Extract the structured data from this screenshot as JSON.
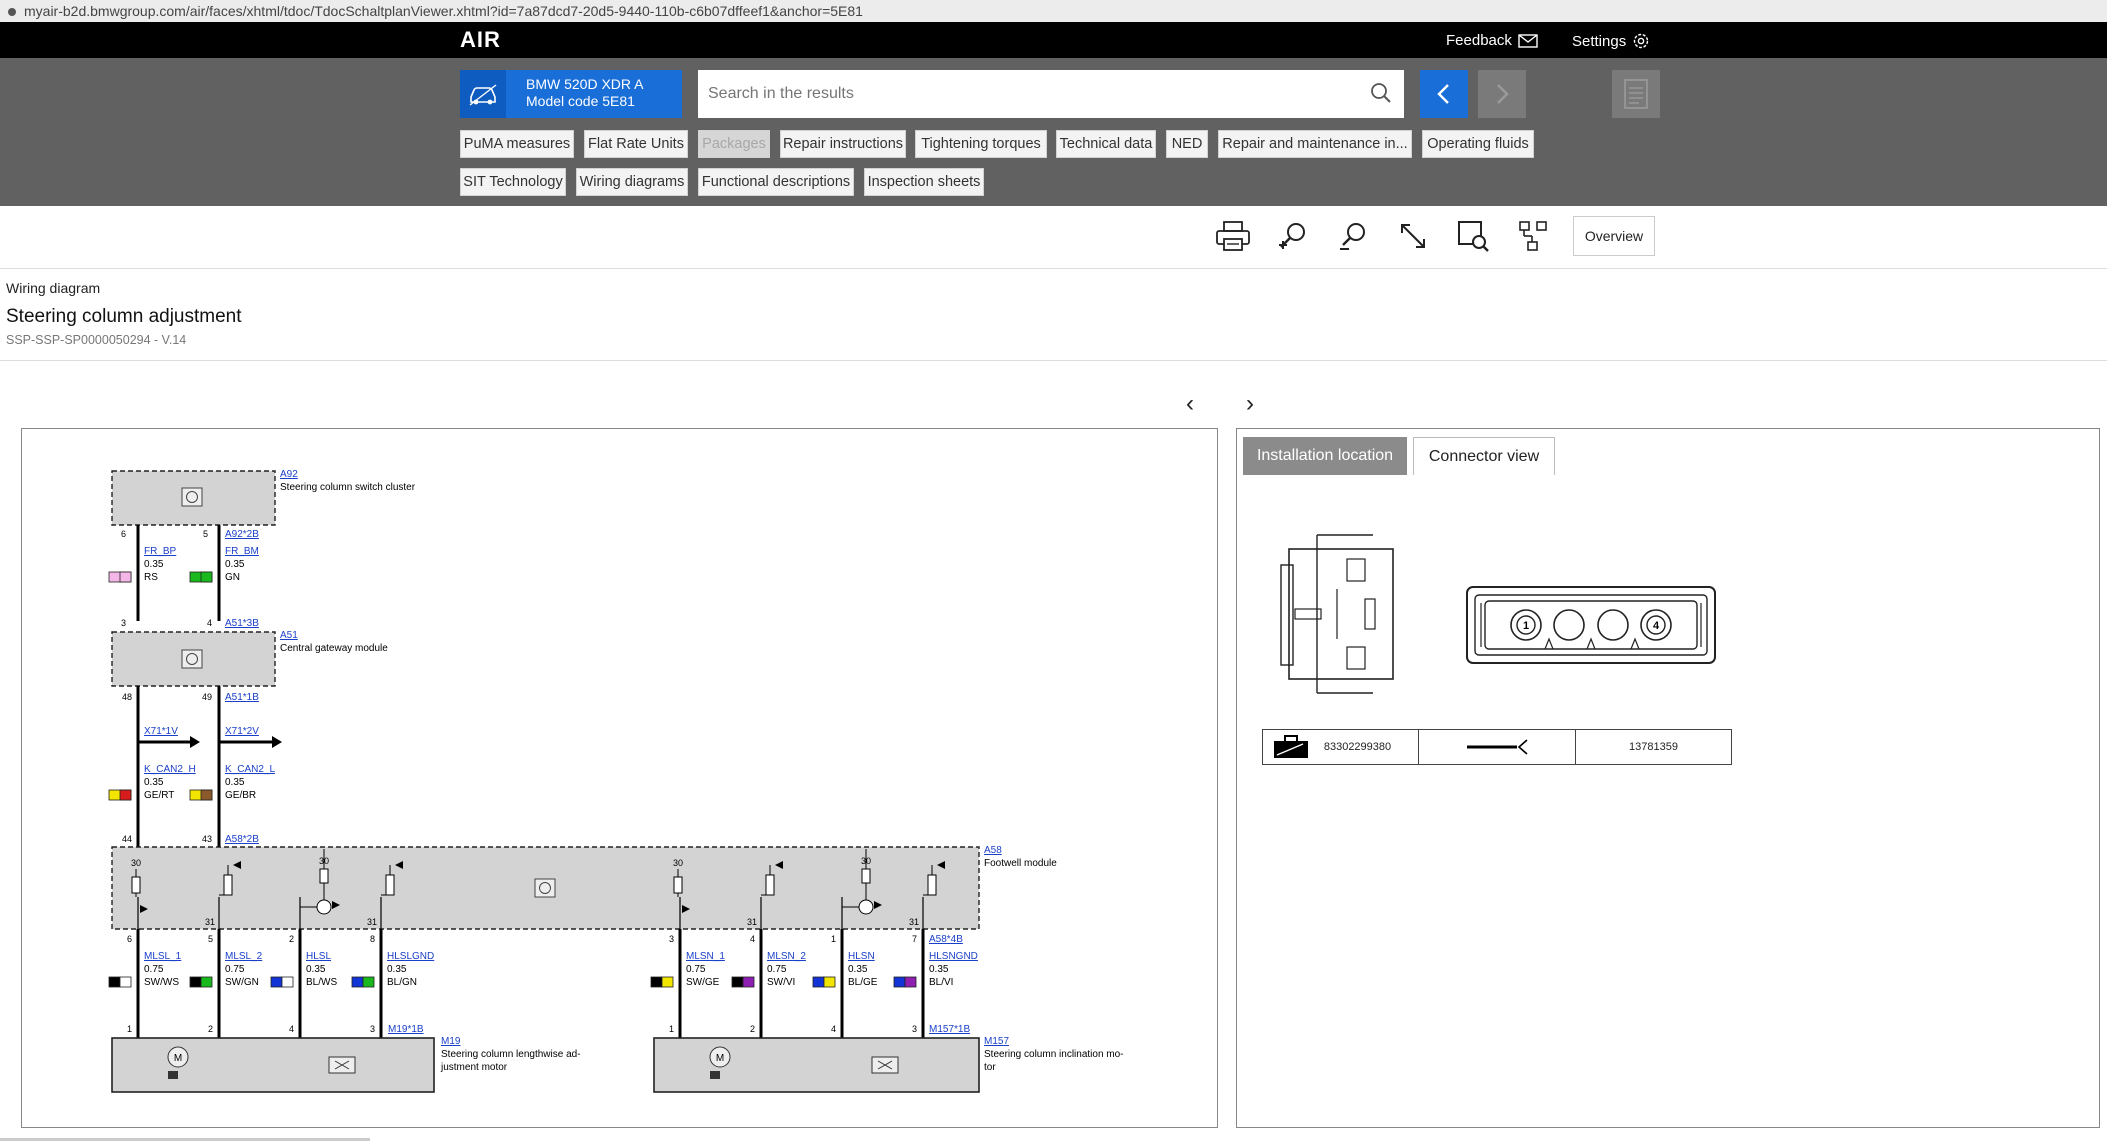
{
  "browser": {
    "url": "myair-b2d.bmwgroup.com/air/faces/xhtml/tdoc/TdocSchaltplanViewer.xhtml?id=7a87dcd7-20d5-9440-110b-c6b07dffeef1&anchor=5E81"
  },
  "header": {
    "logo": "AIR",
    "feedback": "Feedback",
    "settings": "Settings"
  },
  "vehicle": {
    "line1": "BMW 520D XDR A",
    "line2": "Model code 5E81"
  },
  "search": {
    "placeholder": "Search in the results"
  },
  "categories": [
    "PuMA measures",
    "Flat Rate Units",
    "Packages",
    "Repair instructions",
    "Tightening torques",
    "Technical data",
    "NED",
    "Repair and maintenance in...",
    "Operating fluids",
    "SIT Technology",
    "Wiring diagrams",
    "Functional descriptions",
    "Inspection sheets"
  ],
  "toolbar": {
    "overview": "Overview"
  },
  "document": {
    "breadcrumb": "Wiring diagram",
    "title": "Steering column adjustment",
    "id": "SSP-SSP-SP0000050294 - V.14"
  },
  "panel": {
    "tabs": [
      "Installation location",
      "Connector view"
    ],
    "connector_pins": [
      "1",
      "4"
    ],
    "parts": {
      "part_number": "83302299380",
      "number": "13781359"
    }
  },
  "diagram": {
    "a92": {
      "code": "A92",
      "name": "Steering column switch cluster",
      "conn": "A92*2B",
      "pins": [
        "6",
        "5"
      ]
    },
    "w1": [
      {
        "sig": "FR_BP",
        "size": "0.35",
        "color": "RS",
        "c1": "#f4b6e6",
        "c2": "#f4b6e6"
      },
      {
        "sig": "FR_BM",
        "size": "0.35",
        "color": "GN",
        "c1": "#19b91e",
        "c2": "#19b91e"
      }
    ],
    "a51": {
      "code": "A51",
      "name": "Central gateway module",
      "conn_top": "A51*3B",
      "conn_bot": "A51*1B",
      "pins_top": [
        "3",
        "4"
      ],
      "pins_bot": [
        "48",
        "49"
      ]
    },
    "x71": [
      "X71*1V",
      "X71*2V"
    ],
    "w2": [
      {
        "sig": "K_CAN2_H",
        "size": "0.35",
        "color": "GE/RT",
        "c1": "#f2e600",
        "c2": "#d81b1b"
      },
      {
        "sig": "K_CAN2_L",
        "size": "0.35",
        "color": "GE/BR",
        "c1": "#f2e600",
        "c2": "#8b5a2b"
      }
    ],
    "a58": {
      "code": "A58",
      "name": "Footwell module",
      "conn_top": "A58*2B",
      "conn_bot": "A58*4B",
      "pins_top": [
        "44",
        "43"
      ],
      "pins_bot": [
        "6",
        "5",
        "2",
        "8",
        "3",
        "4",
        "1",
        "7"
      ]
    },
    "w3": [
      {
        "sig": "MLSL_1",
        "size": "0.75",
        "color": "SW/WS",
        "c1": "#000000",
        "c2": "#ffffff"
      },
      {
        "sig": "MLSL_2",
        "size": "0.75",
        "color": "SW/GN",
        "c1": "#000000",
        "c2": "#19b91e"
      },
      {
        "sig": "HLSL",
        "size": "0.35",
        "color": "BL/WS",
        "c1": "#1233d6",
        "c2": "#ffffff"
      },
      {
        "sig": "HLSLGND",
        "size": "0.35",
        "color": "BL/GN",
        "c1": "#1233d6",
        "c2": "#19b91e"
      },
      {
        "sig": "MLSN_1",
        "size": "0.75",
        "color": "SW/GE",
        "c1": "#000000",
        "c2": "#f2e600"
      },
      {
        "sig": "MLSN_2",
        "size": "0.75",
        "color": "SW/VI",
        "c1": "#000000",
        "c2": "#8e1fb0"
      },
      {
        "sig": "HLSN",
        "size": "0.35",
        "color": "BL/GE",
        "c1": "#1233d6",
        "c2": "#f2e600"
      },
      {
        "sig": "HLSNGND",
        "size": "0.35",
        "color": "BL/VI",
        "c1": "#1233d6",
        "c2": "#8e1fb0"
      }
    ],
    "terminals": [
      "30",
      "31"
    ],
    "m19": {
      "code": "M19",
      "name_line1": "Steering column lengthwise ad-",
      "name_line2": "justment motor",
      "conn": "M19*1B",
      "pins": [
        "1",
        "2",
        "4",
        "3"
      ]
    },
    "m157": {
      "code": "M157",
      "name_line1": "Steering column inclination mo-",
      "name_line2": "tor",
      "conn": "M157*1B",
      "pins": [
        "1",
        "2",
        "4",
        "3"
      ]
    }
  }
}
